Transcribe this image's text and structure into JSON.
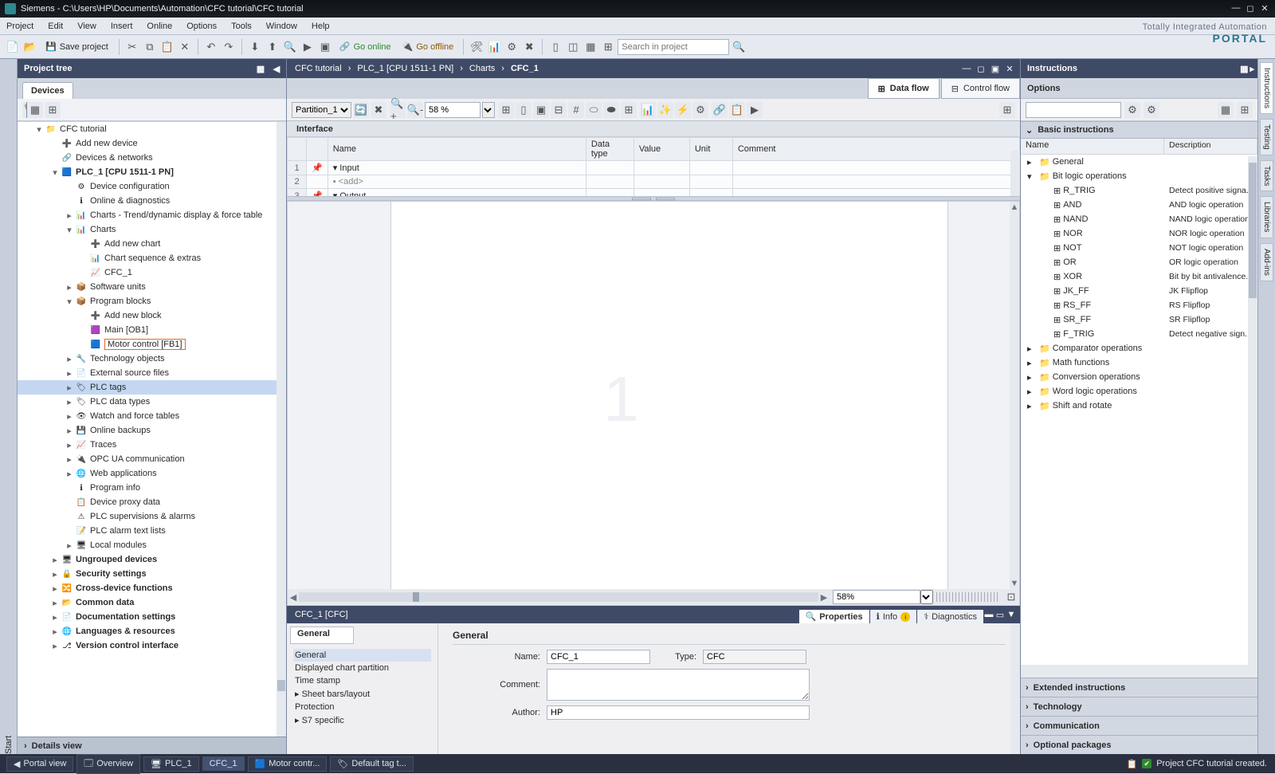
{
  "window": {
    "title": "Siemens  -  C:\\Users\\HP\\Documents\\Automation\\CFC tutorial\\CFC tutorial"
  },
  "menu": [
    "Project",
    "Edit",
    "View",
    "Insert",
    "Online",
    "Options",
    "Tools",
    "Window",
    "Help"
  ],
  "branding": {
    "line1": "Totally Integrated Automation",
    "line2": "PORTAL"
  },
  "toolbar": {
    "save_label": "Save project",
    "go_online": "Go online",
    "go_offline": "Go offline",
    "search_ph": "Search in project"
  },
  "startbar": {
    "label": "Start"
  },
  "project_tree": {
    "title": "Project tree",
    "tab": "Devices",
    "details": "Details view",
    "items": [
      {
        "lvl": 1,
        "tw": "▾",
        "icn": "📁",
        "label": "CFC tutorial"
      },
      {
        "lvl": 2,
        "tw": "",
        "icn": "➕",
        "label": "Add new device"
      },
      {
        "lvl": 2,
        "tw": "",
        "icn": "🔗",
        "label": "Devices & networks"
      },
      {
        "lvl": 2,
        "tw": "▾",
        "icn": "🟦",
        "label": "PLC_1 [CPU 1511-1 PN]",
        "bold": true
      },
      {
        "lvl": 3,
        "tw": "",
        "icn": "⚙",
        "label": "Device configuration"
      },
      {
        "lvl": 3,
        "tw": "",
        "icn": "ℹ",
        "label": "Online & diagnostics"
      },
      {
        "lvl": 3,
        "tw": "▸",
        "icn": "📊",
        "label": "Charts - Trend/dynamic display & force table"
      },
      {
        "lvl": 3,
        "tw": "▾",
        "icn": "📊",
        "label": "Charts"
      },
      {
        "lvl": 4,
        "tw": "",
        "icn": "➕",
        "label": "Add new chart"
      },
      {
        "lvl": 4,
        "tw": "",
        "icn": "📊",
        "label": "Chart sequence & extras"
      },
      {
        "lvl": 4,
        "tw": "",
        "icn": "📈",
        "label": "CFC_1"
      },
      {
        "lvl": 3,
        "tw": "▸",
        "icn": "📦",
        "label": "Software units"
      },
      {
        "lvl": 3,
        "tw": "▾",
        "icn": "📦",
        "label": "Program blocks"
      },
      {
        "lvl": 4,
        "tw": "",
        "icn": "➕",
        "label": "Add new block"
      },
      {
        "lvl": 4,
        "tw": "",
        "icn": "🟪",
        "label": "Main [OB1]"
      },
      {
        "lvl": 4,
        "tw": "",
        "icn": "🟦",
        "label": "Motor control [FB1]",
        "hl": true
      },
      {
        "lvl": 3,
        "tw": "▸",
        "icn": "🔧",
        "label": "Technology objects"
      },
      {
        "lvl": 3,
        "tw": "▸",
        "icn": "📄",
        "label": "External source files"
      },
      {
        "lvl": 3,
        "tw": "▸",
        "icn": "🏷",
        "label": "PLC tags",
        "sel": true
      },
      {
        "lvl": 3,
        "tw": "▸",
        "icn": "🏷",
        "label": "PLC data types"
      },
      {
        "lvl": 3,
        "tw": "▸",
        "icn": "👁",
        "label": "Watch and force tables"
      },
      {
        "lvl": 3,
        "tw": "▸",
        "icn": "💾",
        "label": "Online backups"
      },
      {
        "lvl": 3,
        "tw": "▸",
        "icn": "📈",
        "label": "Traces"
      },
      {
        "lvl": 3,
        "tw": "▸",
        "icn": "🔌",
        "label": "OPC UA communication"
      },
      {
        "lvl": 3,
        "tw": "▸",
        "icn": "🌐",
        "label": "Web applications"
      },
      {
        "lvl": 3,
        "tw": "",
        "icn": "ℹ",
        "label": "Program info"
      },
      {
        "lvl": 3,
        "tw": "",
        "icn": "📋",
        "label": "Device proxy data"
      },
      {
        "lvl": 3,
        "tw": "",
        "icn": "⚠",
        "label": "PLC supervisions & alarms"
      },
      {
        "lvl": 3,
        "tw": "",
        "icn": "📝",
        "label": "PLC alarm text lists"
      },
      {
        "lvl": 3,
        "tw": "▸",
        "icn": "🖥",
        "label": "Local modules"
      },
      {
        "lvl": 2,
        "tw": "▸",
        "icn": "🖥",
        "label": "Ungrouped devices",
        "bold": true
      },
      {
        "lvl": 2,
        "tw": "▸",
        "icn": "🔒",
        "label": "Security settings",
        "bold": true
      },
      {
        "lvl": 2,
        "tw": "▸",
        "icn": "🔀",
        "label": "Cross-device functions",
        "bold": true
      },
      {
        "lvl": 2,
        "tw": "▸",
        "icn": "📂",
        "label": "Common data",
        "bold": true
      },
      {
        "lvl": 2,
        "tw": "▸",
        "icn": "📄",
        "label": "Documentation settings",
        "bold": true
      },
      {
        "lvl": 2,
        "tw": "▸",
        "icn": "🌐",
        "label": "Languages & resources",
        "bold": true
      },
      {
        "lvl": 2,
        "tw": "▸",
        "icn": "⎇",
        "label": "Version control interface",
        "bold": true
      }
    ]
  },
  "editor": {
    "breadcrumb": [
      "CFC tutorial",
      "PLC_1 [CPU 1511-1 PN]",
      "Charts",
      "CFC_1"
    ],
    "flow_tabs": {
      "data": "Data flow",
      "control": "Control flow"
    },
    "partition": "Partition_1",
    "zoom_field": "58 %",
    "interface_title": "Interface",
    "iface_cols": [
      "Name",
      "Data type",
      "Value",
      "Unit",
      "Comment"
    ],
    "iface_rows": [
      {
        "n": "1",
        "name": "▾  Input"
      },
      {
        "n": "2",
        "name": "      ▪    <add>",
        "grey": true
      },
      {
        "n": "3",
        "name": "▾  Output"
      }
    ],
    "canvas_zoom": "58%",
    "big": "1"
  },
  "properties": {
    "title": "CFC_1 [CFC]",
    "tabs": {
      "prop": "Properties",
      "info": "Info",
      "diag": "Diagnostics"
    },
    "nav": [
      "General",
      "Displayed chart partition",
      "Time stamp",
      "Sheet bars/layout",
      "Protection",
      "S7 specific"
    ],
    "nav_general_tab": "General",
    "section": "General",
    "fields": {
      "name_lbl": "Name:",
      "name_val": "CFC_1",
      "type_lbl": "Type:",
      "type_val": "CFC",
      "comment_lbl": "Comment:",
      "comment_val": "",
      "author_lbl": "Author:",
      "author_val": "HP"
    }
  },
  "instructions": {
    "title": "Instructions",
    "options": "Options",
    "basic": "Basic instructions",
    "cols": {
      "name": "Name",
      "desc": "Description"
    },
    "rows": [
      {
        "ind": 0,
        "tw": "▸",
        "icn": "📁",
        "name": "General",
        "desc": ""
      },
      {
        "ind": 0,
        "tw": "▾",
        "icn": "📁",
        "name": "Bit logic operations",
        "desc": ""
      },
      {
        "ind": 1,
        "tw": "",
        "icn": "⊞",
        "name": "R_TRIG",
        "desc": "Detect positive signa..."
      },
      {
        "ind": 1,
        "tw": "",
        "icn": "⊞",
        "name": "AND",
        "desc": "AND logic operation"
      },
      {
        "ind": 1,
        "tw": "",
        "icn": "⊞",
        "name": "NAND",
        "desc": "NAND logic operation"
      },
      {
        "ind": 1,
        "tw": "",
        "icn": "⊞",
        "name": "NOR",
        "desc": "NOR logic operation"
      },
      {
        "ind": 1,
        "tw": "",
        "icn": "⊞",
        "name": "NOT",
        "desc": "NOT logic operation"
      },
      {
        "ind": 1,
        "tw": "",
        "icn": "⊞",
        "name": "OR",
        "desc": "OR logic operation"
      },
      {
        "ind": 1,
        "tw": "",
        "icn": "⊞",
        "name": "XOR",
        "desc": "Bit by bit antivalence..."
      },
      {
        "ind": 1,
        "tw": "",
        "icn": "⊞",
        "name": "JK_FF",
        "desc": "JK Flipflop"
      },
      {
        "ind": 1,
        "tw": "",
        "icn": "⊞",
        "name": "RS_FF",
        "desc": "RS Flipflop"
      },
      {
        "ind": 1,
        "tw": "",
        "icn": "⊞",
        "name": "SR_FF",
        "desc": "SR Flipflop"
      },
      {
        "ind": 1,
        "tw": "",
        "icn": "⊞",
        "name": "F_TRIG",
        "desc": "Detect negative sign..."
      },
      {
        "ind": 0,
        "tw": "▸",
        "icn": "📁",
        "name": "Comparator operations",
        "desc": ""
      },
      {
        "ind": 0,
        "tw": "▸",
        "icn": "📁",
        "name": "Math functions",
        "desc": ""
      },
      {
        "ind": 0,
        "tw": "▸",
        "icn": "📁",
        "name": "Conversion operations",
        "desc": ""
      },
      {
        "ind": 0,
        "tw": "▸",
        "icn": "📁",
        "name": "Word logic operations",
        "desc": ""
      },
      {
        "ind": 0,
        "tw": "▸",
        "icn": "📁",
        "name": "Shift and rotate",
        "desc": ""
      }
    ],
    "accordions": [
      "Extended instructions",
      "Technology",
      "Communication",
      "Optional packages"
    ]
  },
  "side_tabs": [
    "Instructions",
    "Testing",
    "Tasks",
    "Libraries",
    "Add-ins"
  ],
  "statusbar": {
    "portal": "Portal view",
    "tabs": [
      "Overview",
      "PLC_1",
      "CFC_1",
      "Motor contr...",
      "Default tag t..."
    ],
    "msg": "Project CFC tutorial created."
  }
}
